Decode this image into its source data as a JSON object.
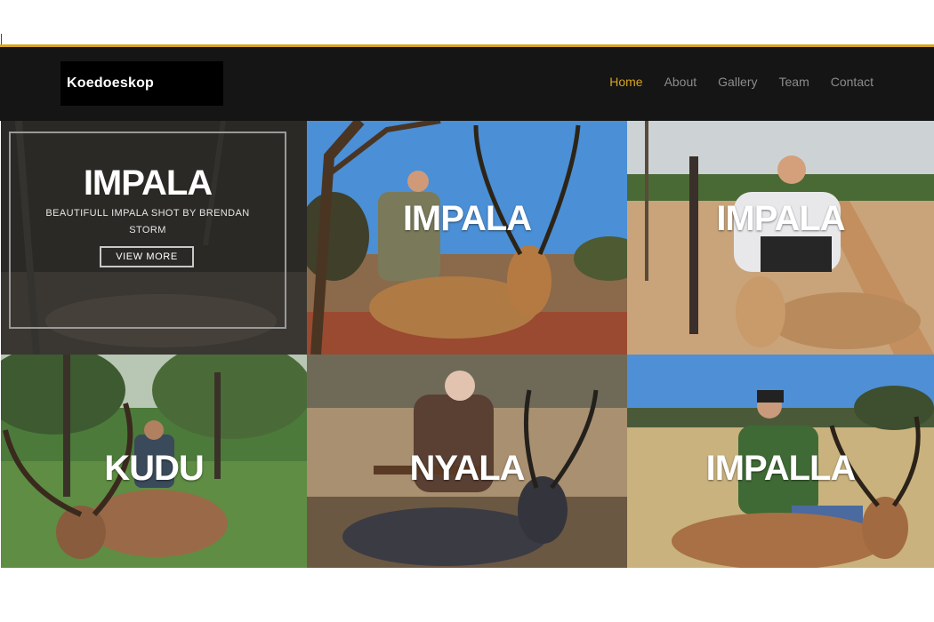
{
  "header": {
    "brand": "Koedoeskop",
    "nav": [
      {
        "label": "Home",
        "active": true
      },
      {
        "label": "About",
        "active": false
      },
      {
        "label": "Gallery",
        "active": false
      },
      {
        "label": "Team",
        "active": false
      },
      {
        "label": "Contact",
        "active": false
      }
    ],
    "accent_color": "#d6a321"
  },
  "feature": {
    "title": "IMPALA",
    "description": "BEAUTIFULL IMPALA SHOT BY BRENDAN STORM",
    "button_label": "VIEW MORE"
  },
  "gallery": [
    {
      "label": "IMPALA"
    },
    {
      "label": "IMPALA"
    },
    {
      "label": "KUDU"
    },
    {
      "label": "NYALA"
    },
    {
      "label": "IMPALLA"
    }
  ]
}
